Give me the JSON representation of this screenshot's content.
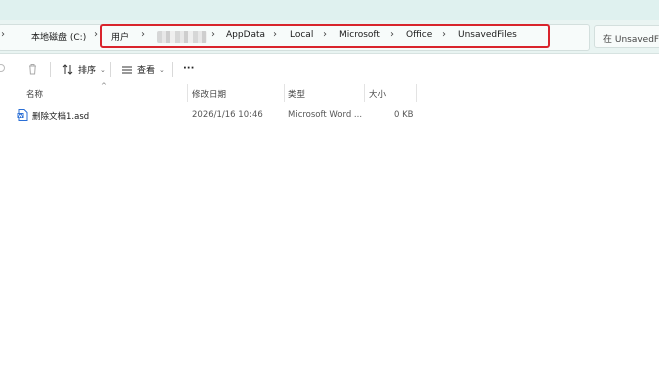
{
  "breadcrumb": {
    "drive": "本地磁盘 (C:)",
    "items": [
      "用户",
      "AppData",
      "Local",
      "Microsoft",
      "Office",
      "UnsavedFiles"
    ]
  },
  "search": {
    "placeholder": "在 UnsavedFiles"
  },
  "toolbar": {
    "sort_label": "排序",
    "view_label": "查看",
    "more_label": "···"
  },
  "columns": {
    "name": "名称",
    "modified": "修改日期",
    "type": "类型",
    "size": "大小"
  },
  "files": [
    {
      "name": "删除文档1.asd",
      "modified": "2026/1/16 10:46",
      "type": "Microsoft Word ...",
      "size": "0 KB"
    }
  ],
  "colors": {
    "highlight": "#d9242c",
    "addrbar_bg": "#e9f4f2",
    "file_icon": "#2b6fd6"
  }
}
